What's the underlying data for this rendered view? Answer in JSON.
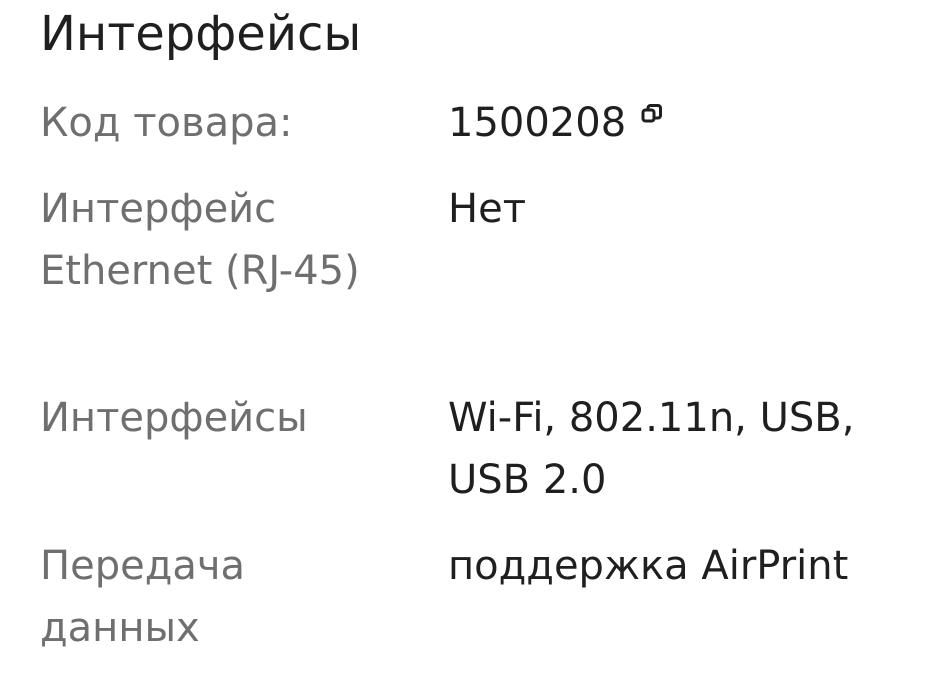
{
  "header": {
    "title": "Интерфейсы"
  },
  "specs": {
    "product_code": {
      "label": "Код товара:",
      "value": "1500208",
      "icon": "copy-icon"
    },
    "ethernet": {
      "label": "Интерфейс Ethernet (RJ-45)",
      "value": "Нет"
    },
    "interfaces": {
      "label": "Интерфейсы",
      "value": "Wi-Fi, 802.11n, USB, USB 2.0"
    },
    "data_transfer": {
      "label": "Передача данных",
      "value": "поддержка AirPrint"
    }
  },
  "colors": {
    "background": "#ffffff",
    "text_primary": "#1f1f1f",
    "text_secondary": "#6f6f6f"
  }
}
